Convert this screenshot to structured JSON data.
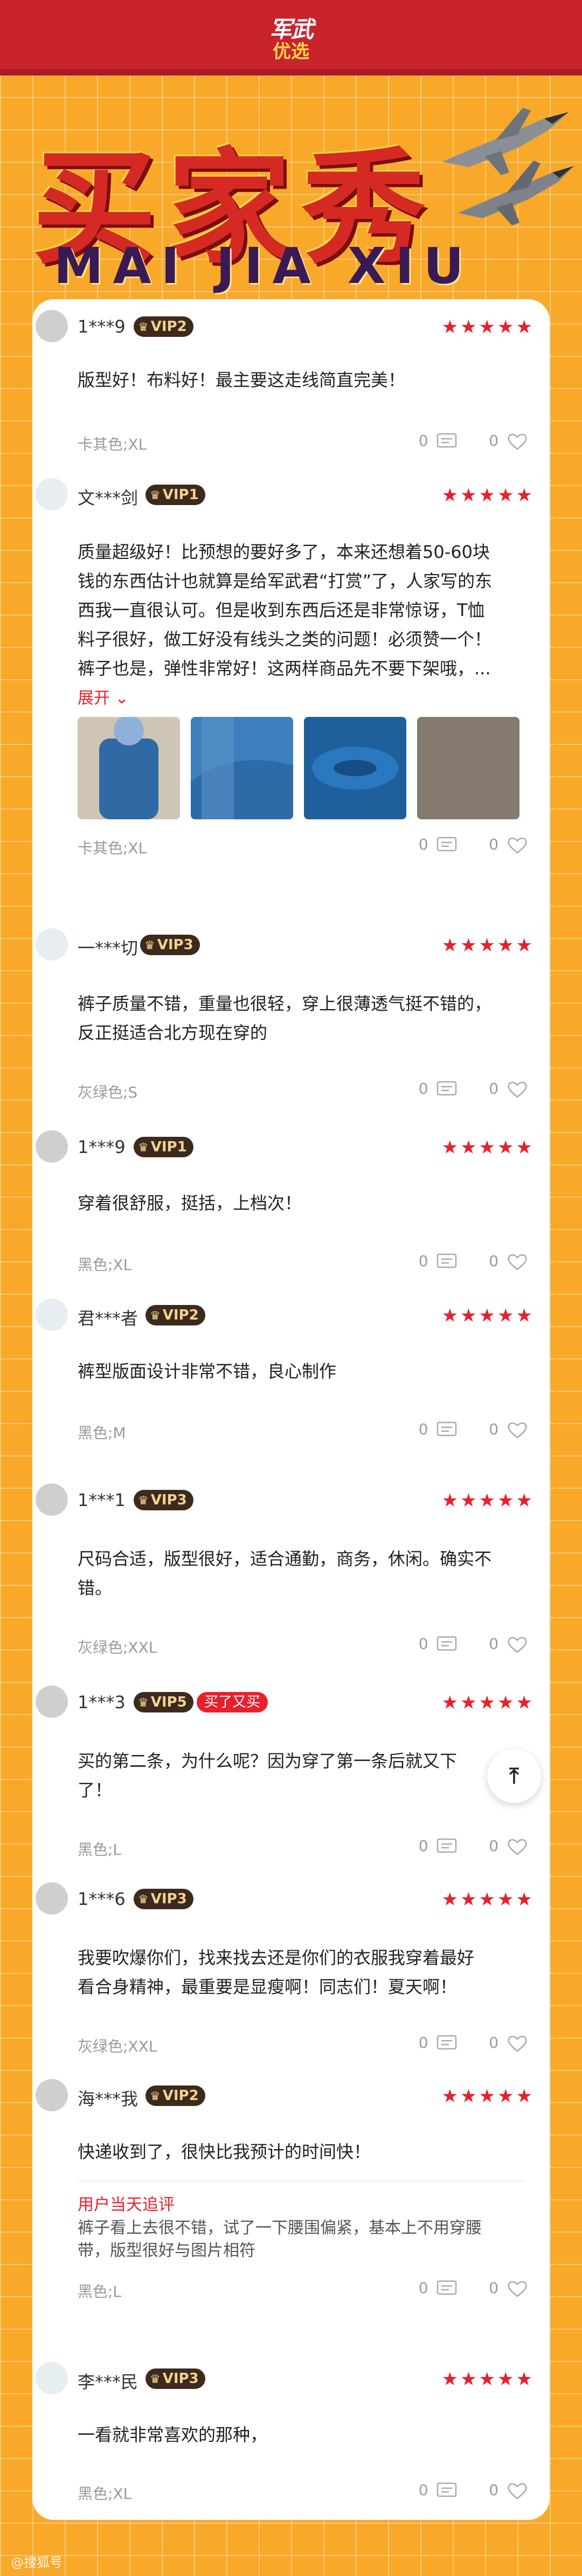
{
  "brand": {
    "line1": "军武",
    "line2": "优选"
  },
  "hero": {
    "title": "买家秀",
    "subtitle": "MAI JIA XIU"
  },
  "colors": {
    "accent": "#e8202c",
    "background": "#f8a92a",
    "header": "#c9232d"
  },
  "reviews": [
    {
      "user": "1***9",
      "vip": "VIP2",
      "stars": "★★★★★",
      "text": [
        "版型好！布料好！最主要这走线简直完美！"
      ],
      "sku": "卡其色;XL",
      "comments": "0",
      "likes": "0"
    },
    {
      "user": "文***剑",
      "vip": "VIP1",
      "stars": "★★★★★",
      "text": [
        "质量超级好！比预想的要好多了，本来还想着50-60块",
        "钱的东西估计也就算是给军武君“打赏”了，人家写的东",
        "西我一直很认可。但是收到东西后还是非常惊讶，T恤",
        "料子很好，做工好没有线头之类的问题！必须赞一个！",
        "裤子也是，弹性非常好！这两样商品先不要下架哦，..."
      ],
      "expand": "展开",
      "sku": "卡其色;XL",
      "comments": "0",
      "likes": "0"
    },
    {
      "user": "一***切",
      "vip": "VIP3",
      "stars": "★★★★★",
      "text": [
        "裤子质量不错，重量也很轻，穿上很薄透气挺不错的，",
        "反正挺适合北方现在穿的"
      ],
      "sku": "灰绿色;S",
      "comments": "0",
      "likes": "0"
    },
    {
      "user": "1***9",
      "vip": "VIP1",
      "stars": "★★★★★",
      "text": [
        "穿着很舒服，挺括，上档次！"
      ],
      "sku": "黑色;XL",
      "comments": "0",
      "likes": "0"
    },
    {
      "user": "君***者",
      "vip": "VIP2",
      "stars": "★★★★★",
      "text": [
        "裤型版面设计非常不错，良心制作"
      ],
      "sku": "黑色;M",
      "comments": "0",
      "likes": "0"
    },
    {
      "user": "1***1",
      "vip": "VIP3",
      "stars": "★★★★★",
      "text": [
        "尺码合适，版型很好，适合通勤，商务，休闲。确实不",
        "错。"
      ],
      "sku": "灰绿色;XXL",
      "comments": "0",
      "likes": "0"
    },
    {
      "user": "1***3",
      "vip": "VIP5",
      "badge": "买了又买",
      "stars": "★★★★★",
      "text": [
        "买的第二条，为什么呢？因为穿了第一条后就又下",
        "了！"
      ],
      "sku": "黑色;L",
      "comments": "0",
      "likes": "0"
    },
    {
      "user": "1***6",
      "vip": "VIP3",
      "stars": "★★★★★",
      "text": [
        "我要吹爆你们，找来找去还是你们的衣服我穿着最好",
        "看合身精神，最重要是显瘦啊！同志们！夏天啊！"
      ],
      "sku": "灰绿色;XXL",
      "comments": "0",
      "likes": "0"
    },
    {
      "user": "海***我",
      "vip": "VIP2",
      "stars": "★★★★★",
      "text": [
        "快递收到了，很快比我预计的时间快！"
      ],
      "followup_title": "用户当天追评",
      "followup": [
        "裤子看上去很不错，试了一下腰围偏紧，基本上不用穿腰",
        "带，版型很好与图片相符"
      ],
      "sku": "黑色;L",
      "comments": "0",
      "likes": "0"
    },
    {
      "user": "李***民",
      "vip": "VIP3",
      "stars": "★★★★★",
      "text": [
        "一看就非常喜欢的那种，"
      ],
      "sku": "黑色;XL",
      "comments": "0",
      "likes": "0"
    }
  ],
  "watermark": "@搜狐号"
}
